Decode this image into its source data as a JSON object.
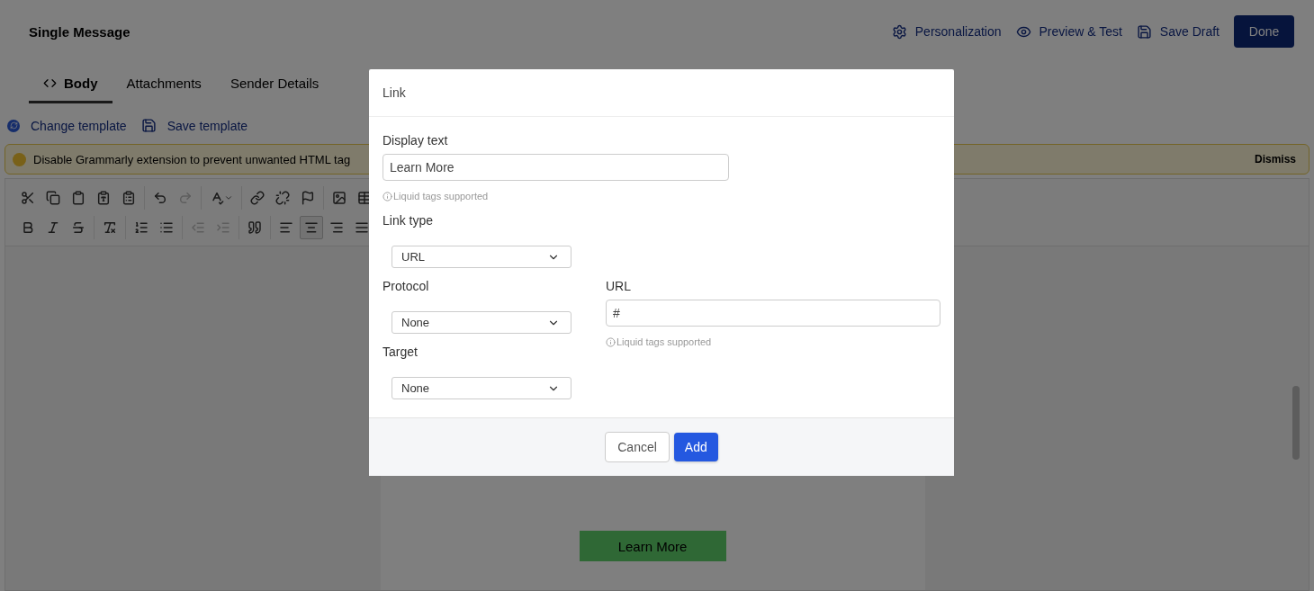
{
  "header": {
    "title": "Single Message",
    "actions": [
      {
        "kind": "gear",
        "label": "Personalization"
      },
      {
        "kind": "eye",
        "label": "Preview & Test"
      },
      {
        "kind": "save",
        "label": "Save Draft"
      }
    ],
    "done_button": "Done"
  },
  "tabs": [
    {
      "kind": "code",
      "label": "Body",
      "selected": true
    },
    {
      "kind": "plain",
      "label": "Attachments",
      "selected": false
    },
    {
      "kind": "plain",
      "label": "Sender Details",
      "selected": false
    }
  ],
  "template_actions": [
    {
      "kind": "change",
      "label": "Change template"
    },
    {
      "kind": "save",
      "label": "Save template"
    }
  ],
  "notice": {
    "text": "Disable Grammarly extension to prevent unwanted HTML tag",
    "dismiss": "Dismiss"
  },
  "toolbar": [
    [
      [
        {
          "kind": "cut",
          "disabled": false,
          "active": false
        },
        {
          "kind": "copy",
          "disabled": false,
          "active": false
        },
        {
          "kind": "paste",
          "disabled": false,
          "active": false
        },
        {
          "kind": "paste-text",
          "disabled": false,
          "active": false
        },
        {
          "kind": "paste-word",
          "disabled": false,
          "active": false
        }
      ],
      [
        {
          "kind": "undo",
          "disabled": false,
          "active": false
        },
        {
          "kind": "redo",
          "disabled": true,
          "active": false
        }
      ],
      [
        {
          "kind": "spellcheck",
          "disabled": false,
          "active": false
        }
      ],
      [
        {
          "kind": "link",
          "disabled": false,
          "active": false
        },
        {
          "kind": "unlink",
          "disabled": false,
          "active": false
        },
        {
          "kind": "anchor",
          "disabled": false,
          "active": false
        }
      ],
      [
        {
          "kind": "image",
          "disabled": false,
          "active": false
        },
        {
          "kind": "table",
          "disabled": false,
          "active": false
        }
      ]
    ],
    [
      [
        {
          "kind": "bold",
          "disabled": false,
          "active": false
        },
        {
          "kind": "italic",
          "disabled": false,
          "active": false
        },
        {
          "kind": "strike",
          "disabled": false,
          "active": false
        }
      ],
      [
        {
          "kind": "clear-format",
          "disabled": false,
          "active": false
        }
      ],
      [
        {
          "kind": "ordered-list",
          "disabled": false,
          "active": false
        },
        {
          "kind": "bullet-list",
          "disabled": false,
          "active": false
        }
      ],
      [
        {
          "kind": "outdent",
          "disabled": true,
          "active": false
        },
        {
          "kind": "indent",
          "disabled": true,
          "active": false
        }
      ],
      [
        {
          "kind": "quote",
          "disabled": false,
          "active": false
        }
      ],
      [
        {
          "kind": "align-left",
          "disabled": false,
          "active": false
        },
        {
          "kind": "align-center",
          "disabled": false,
          "active": true
        },
        {
          "kind": "align-right",
          "disabled": false,
          "active": false
        },
        {
          "kind": "justify",
          "disabled": false,
          "active": false
        }
      ]
    ]
  ],
  "canvas": {
    "button": "Learn More"
  },
  "dialog": {
    "title": "Link",
    "display_text": {
      "label": "Display text",
      "value": "Learn More",
      "hint": "Liquid tags supported"
    },
    "link_type": {
      "label": "Link type",
      "value": "URL"
    },
    "protocol": {
      "label": "Protocol",
      "value": "None"
    },
    "url": {
      "label": "URL",
      "value": "#",
      "hint": "Liquid tags supported"
    },
    "target": {
      "label": "Target",
      "value": "None"
    },
    "cancel": "Cancel",
    "add": "Add"
  }
}
